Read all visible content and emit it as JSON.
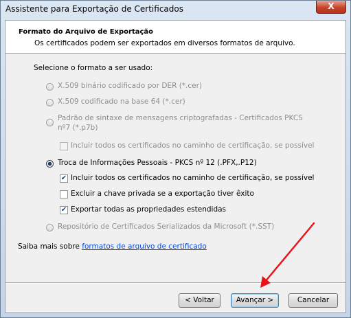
{
  "window": {
    "title": "Assistente para Exportação de Certificados",
    "close_label": "X"
  },
  "header": {
    "title": "Formato do Arquivo de Exportação",
    "subtitle": "Os certificados podem ser exportados em diversos formatos de arquivo."
  },
  "select_label": "Selecione o formato a ser usado:",
  "options": {
    "der": "X.509 binário codificado por DER (*.cer)",
    "base64": "X.509 codificado na base 64 (*.cer)",
    "pkcs7_line1": "Padrão de sintaxe de mensagens criptografadas - Certificados PKCS",
    "pkcs7_line2": "nº7 (*.p7b)",
    "pkcs7_include": "Incluir todos os certificados no caminho de certificação, se possível",
    "pfx": "Troca de Informações Pessoais - PKCS nº 12 (.PFX,.P12)",
    "pfx_include": "Incluir todos os certificados no caminho de certificação, se possível",
    "pfx_delete": "Excluir a chave privada se a exportação tiver êxito",
    "pfx_export_props": "Exportar todas as propriedades estendidas",
    "sst": "Repositório de Certificados Serializados da Microsoft (*.SST)"
  },
  "learn_more": {
    "prefix": "Saiba mais sobre ",
    "link": "formatos de arquivo de certificado"
  },
  "buttons": {
    "back": "< Voltar",
    "next": "Avançar >",
    "cancel": "Cancelar"
  },
  "state": {
    "selected_format": "pfx",
    "pfx_include_checked": true,
    "pfx_delete_checked": false,
    "pfx_export_props_checked": true
  },
  "colors": {
    "annotation_arrow": "#e8141a"
  }
}
